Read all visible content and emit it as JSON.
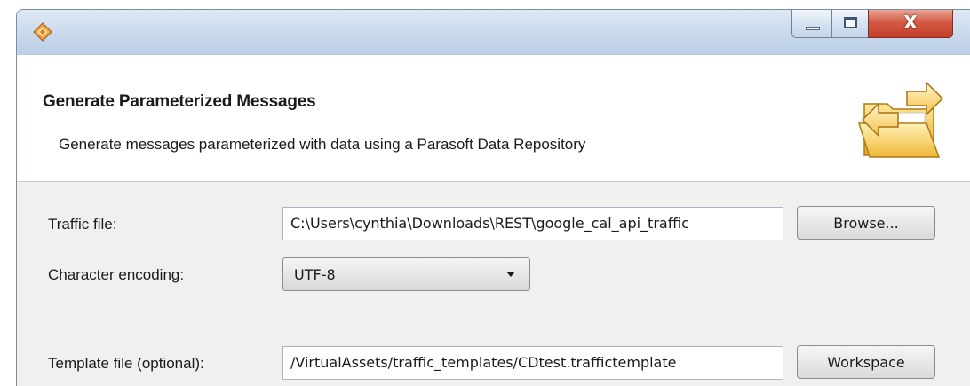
{
  "window": {
    "app_icon": "parasoft-diamond-icon",
    "controls": {
      "minimize_icon": "minimize-icon",
      "maximize_icon": "maximize-icon",
      "close_symbol": "X"
    }
  },
  "header": {
    "title": "Generate Parameterized Messages",
    "description": "Generate messages parameterized with data using a Parasoft Data Repository",
    "icon": "folder-arrows-icon"
  },
  "form": {
    "traffic_file": {
      "label": "Traffic file:",
      "value": "C:\\Users\\cynthia\\Downloads\\REST\\google_cal_api_traffic",
      "button_label": "Browse..."
    },
    "character_encoding": {
      "label": "Character encoding:",
      "selected": "UTF-8"
    },
    "template_file": {
      "label": "Template file (optional):",
      "value": "/VirtualAssets/traffic_templates/CDtest.traffictemplate",
      "button_label": "Workspace"
    }
  },
  "colors": {
    "close_button": "#c33d26",
    "titlebar": "#c9d9ec",
    "header_background": "#ffffff",
    "body_background": "#f0f0f0"
  }
}
